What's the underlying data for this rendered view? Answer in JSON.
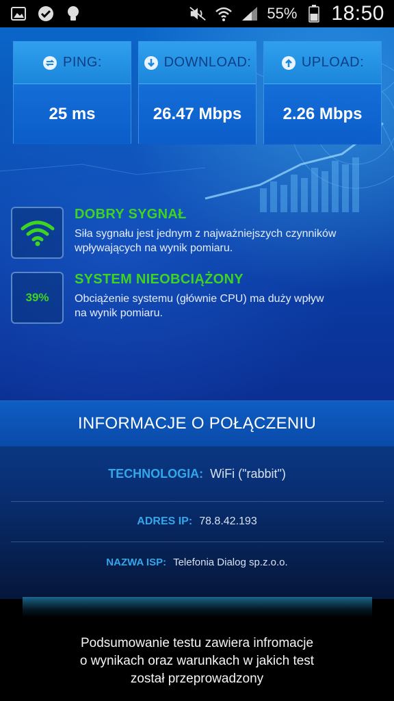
{
  "statusbar": {
    "battery": "55%",
    "time": "18:50",
    "icons": [
      "gallery-icon",
      "check-icon",
      "bulb-icon",
      "mute-icon",
      "wifi-icon",
      "signal-icon",
      "battery-icon"
    ]
  },
  "stats": {
    "ping": {
      "label": "PING:",
      "value": "25 ms"
    },
    "download": {
      "label": "DOWNLOAD:",
      "value": "26.47 Mbps"
    },
    "upload": {
      "label": "UPLOAD:",
      "value": "2.26 Mbps"
    }
  },
  "signal": {
    "title": "DOBRY SYGNAŁ",
    "desc_line1": "Siła sygnału jest jednym z najważniejszych czynników",
    "desc_line2": "wpływających na wynik pomiaru."
  },
  "system": {
    "badge": "39%",
    "title": "SYSTEM NIEOBCIĄŻONY",
    "desc_line1": "Obciążenie systemu (głównie CPU) ma duży wpływ",
    "desc_line2": "na wynik pomiaru."
  },
  "connection": {
    "header": "INFORMACJE O POŁĄCZENIU",
    "technology_label": "TECHNOLOGIA:",
    "technology_value": "WiFi (\"rabbit\")",
    "ip_label": "ADRES IP:",
    "ip_value": "78.8.42.193",
    "isp_label": "NAZWA ISP:",
    "isp_value": "Telefonia Dialog sp.z.o.o."
  },
  "summary": {
    "line1": "Podsumowanie testu zawiera infromacje",
    "line2": "o wynikach oraz warunkach w jakich test",
    "line3": "został przeprowadzony"
  },
  "colors": {
    "accent_green": "#3ed421",
    "label_blue": "#35a6ea",
    "card_blue": "#1c86da"
  }
}
